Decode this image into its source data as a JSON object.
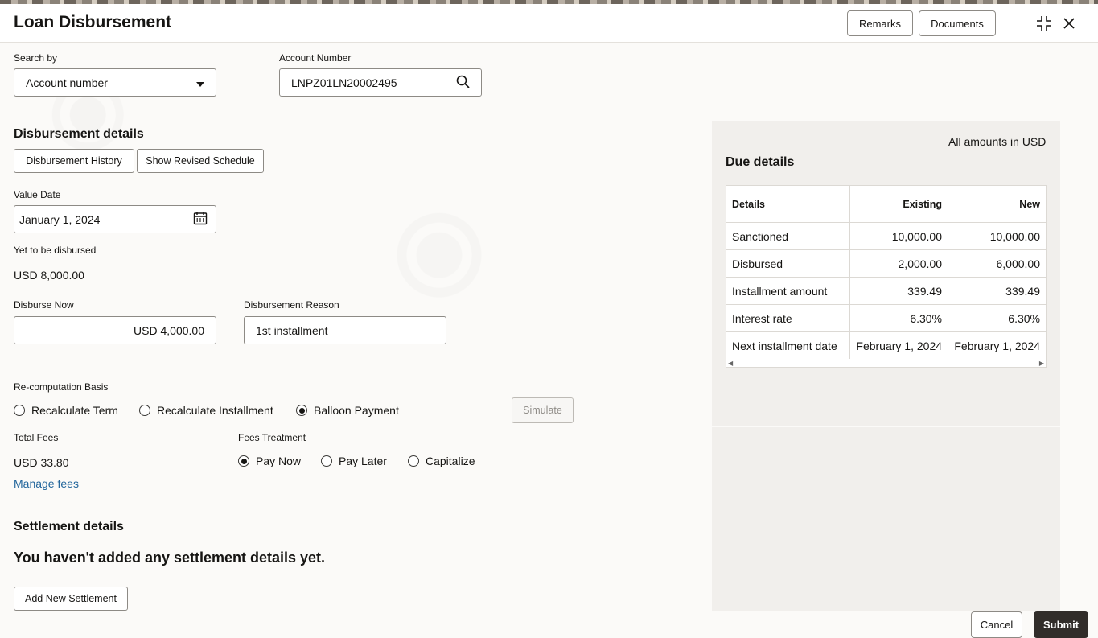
{
  "header": {
    "title": "Loan Disbursement",
    "remarks_label": "Remarks",
    "documents_label": "Documents"
  },
  "search": {
    "search_by_label": "Search by",
    "search_by_value": "Account number",
    "account_number_label": "Account Number",
    "account_number_value": "LNPZ01LN20002495"
  },
  "disbursement": {
    "section_title": "Disbursement details",
    "history_button": "Disbursement History",
    "revised_schedule_button": "Show Revised Schedule",
    "value_date_label": "Value Date",
    "value_date_value": "January 1, 2024",
    "yet_to_be_disbursed_label": "Yet to be disbursed",
    "yet_to_be_disbursed_value": "USD 8,000.00",
    "disburse_now_label": "Disburse Now",
    "disburse_now_value": "USD 4,000.00",
    "reason_label": "Disbursement Reason",
    "reason_value": "1st installment"
  },
  "recomputation": {
    "label": "Re-computation Basis",
    "options": [
      "Recalculate Term",
      "Recalculate Installment",
      "Balloon Payment"
    ],
    "selected": "Balloon Payment",
    "simulate_button": "Simulate"
  },
  "fees": {
    "total_fees_label": "Total Fees",
    "total_fees_value": "USD 33.80",
    "manage_fees_link": "Manage fees",
    "treatment_label": "Fees Treatment",
    "treatment_options": [
      "Pay Now",
      "Pay Later",
      "Capitalize"
    ],
    "treatment_selected": "Pay Now"
  },
  "settlement": {
    "section_title": "Settlement details",
    "empty_message": "You haven't added any settlement details yet.",
    "add_button": "Add New Settlement"
  },
  "due_details": {
    "amounts_note": "All amounts in USD",
    "title": "Due details",
    "columns": [
      "Details",
      "Existing",
      "New"
    ],
    "rows": [
      [
        "Sanctioned",
        "10,000.00",
        "10,000.00"
      ],
      [
        "Disbursed",
        "2,000.00",
        "6,000.00"
      ],
      [
        "Installment amount",
        "339.49",
        "339.49"
      ],
      [
        "Interest rate",
        "6.30%",
        "6.30%"
      ],
      [
        "Next installment date",
        "February 1, 2024",
        "February 1, 2024"
      ]
    ]
  },
  "footer": {
    "cancel_label": "Cancel",
    "submit_label": "Submit"
  },
  "colors": {
    "link": "#22659b",
    "submit_bg": "#312d2a",
    "panel_bg": "#f1efec"
  }
}
